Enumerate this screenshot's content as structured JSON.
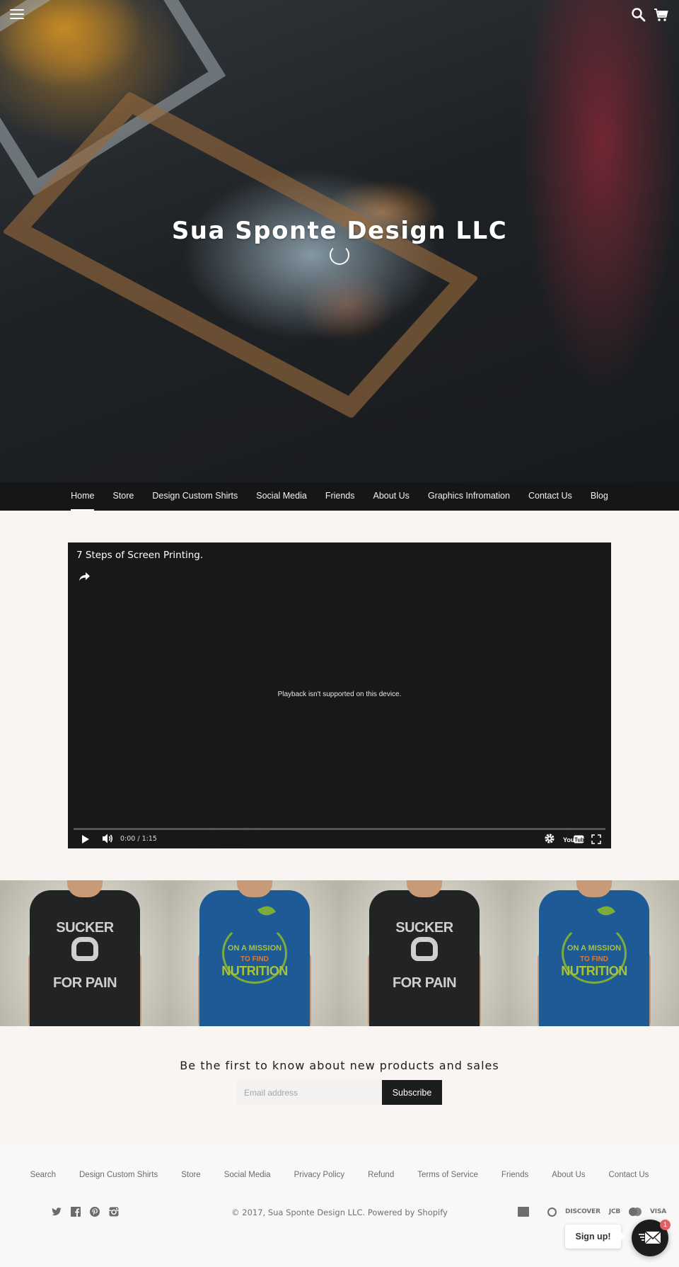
{
  "header": {
    "site_title": "Sua Sponte Design LLC",
    "icons": {
      "menu": "hamburger-menu-icon",
      "search": "search-icon",
      "cart": "cart-icon"
    }
  },
  "nav": {
    "items": [
      {
        "label": "Home",
        "active": true
      },
      {
        "label": "Store"
      },
      {
        "label": "Design Custom Shirts"
      },
      {
        "label": "Social Media"
      },
      {
        "label": "Friends"
      },
      {
        "label": "About Us"
      },
      {
        "label": "Graphics Infromation"
      },
      {
        "label": "Contact Us"
      },
      {
        "label": "Blog"
      }
    ]
  },
  "video": {
    "title": "7 Steps of Screen Printing.",
    "message": "Playback isn't supported on this device.",
    "time": "0:00 / 1:15",
    "progress": 0,
    "icons": [
      "share-icon",
      "play-icon",
      "volume-icon",
      "settings-gear-icon",
      "youtube-logo-icon",
      "fullscreen-icon"
    ]
  },
  "shirts": {
    "panels": [
      {
        "color": "black",
        "lines": [
          "SUCKER",
          "FOR PAIN"
        ]
      },
      {
        "color": "blue",
        "lines": [
          "ON A MISSION",
          "TO FIND",
          "NUTRITION"
        ]
      },
      {
        "color": "black",
        "lines": [
          "SUCKER",
          "FOR PAIN"
        ]
      },
      {
        "color": "blue",
        "lines": [
          "ON A MISSION",
          "TO FIND",
          "NUTRITION"
        ]
      }
    ]
  },
  "newsletter": {
    "heading": "Be the first to know about new products and sales",
    "email_placeholder": "Email address",
    "email_value": "",
    "subscribe_label": "Subscribe"
  },
  "footer": {
    "links": [
      "Search",
      "Design Custom Shirts",
      "Store",
      "Social Media",
      "Privacy Policy",
      "Refund",
      "Terms of Service",
      "Friends",
      "About Us",
      "Contact Us"
    ],
    "social_icons": [
      "twitter-icon",
      "facebook-icon",
      "pinterest-icon",
      "instagram-icon"
    ],
    "copyright_prefix": "© 2017, ",
    "copyright_store": "Sua Sponte Design LLC",
    "copyright_sep": ". ",
    "powered_by": "Powered by Shopify",
    "payments": {
      "amex": "american-express-icon",
      "diners": "diners-club-icon",
      "discover": "DISCOVER",
      "jcb": "JCB",
      "master": "mastercard-icon",
      "visa": "VISA"
    }
  },
  "signup_widget": {
    "label": "Sign up!",
    "badge_count": "1",
    "icon": "envelope-icon"
  },
  "colors": {
    "nav_bg": "#161616",
    "page_bg": "#f8f5f3",
    "button_bg": "#1c1d1d",
    "badge": "#e55f5f"
  }
}
